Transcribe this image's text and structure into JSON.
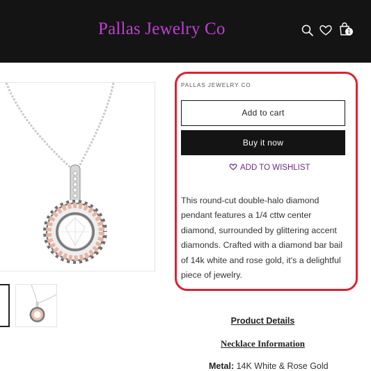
{
  "header": {
    "logo": "Pallas Jewelry Co",
    "icons": [
      "search-icon",
      "heart-icon",
      "cart-icon"
    ],
    "cart_count": "1"
  },
  "gallery": {
    "main_image": "diamond-halo-pendant-image",
    "thumbnails": [
      "thumbnail-1",
      "thumbnail-2"
    ]
  },
  "product": {
    "vendor": "PALLAS JEWELRY CO",
    "add_to_cart": "Add to cart",
    "buy_now": "Buy it now",
    "wishlist": "ADD TO WISHLIST",
    "description": "This round-cut double-halo diamond pendant features a 1/4 cttw center diamond, surrounded by glittering accent diamonds. Crafted with a diamond bar bail of 14k white and rose gold, it's a delightful piece of jewelry."
  },
  "details": {
    "product_details": "Product Details",
    "necklace_info": "Necklace Information",
    "metal_label": "Metal:",
    "metal_value": " 14K White & Rose Gold"
  },
  "colors": {
    "header_bg": "#141414",
    "logo": "#c13ed6",
    "wishlist": "#6a2b80",
    "highlight": "#e0202e"
  }
}
